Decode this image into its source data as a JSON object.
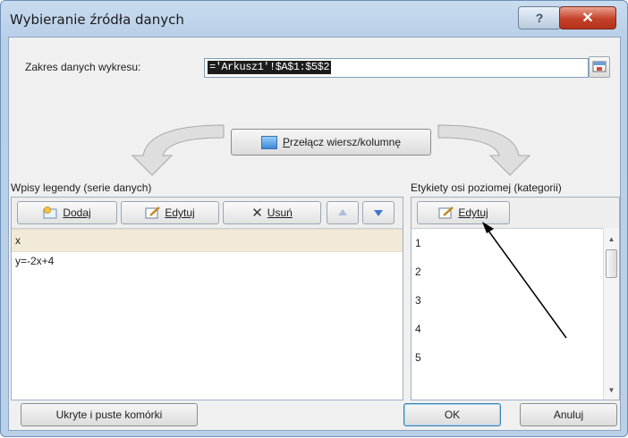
{
  "dialog": {
    "title": "Wybieranie źródła danych",
    "help_label": "?",
    "close_label": "✕"
  },
  "range": {
    "label": "Zakres danych wykresu:",
    "value": "='Arkusz1'!$A$1:$5$2"
  },
  "switch_button": {
    "label_pre": "",
    "label_ul": "P",
    "label_post": "rzełącz wiersz/kolumnę"
  },
  "legend": {
    "header": "Wpisy legendy (serie danych)",
    "add": "Dodaj",
    "edit": "Edytuj",
    "remove": "Usuń",
    "entries": [
      "x",
      "y=-2x+4"
    ]
  },
  "axis": {
    "header": "Etykiety osi poziomej (kategorii)",
    "edit": "Edytuj",
    "items": [
      "1",
      "2",
      "3",
      "4",
      "5"
    ]
  },
  "footer": {
    "hidden_cells": "Ukryte i puste komórki",
    "ok": "OK",
    "cancel": "Anuluj"
  },
  "colors": {
    "title_bar": "#c9dcef",
    "close_button": "#c4412a",
    "selected_row": "#f1ead9"
  }
}
